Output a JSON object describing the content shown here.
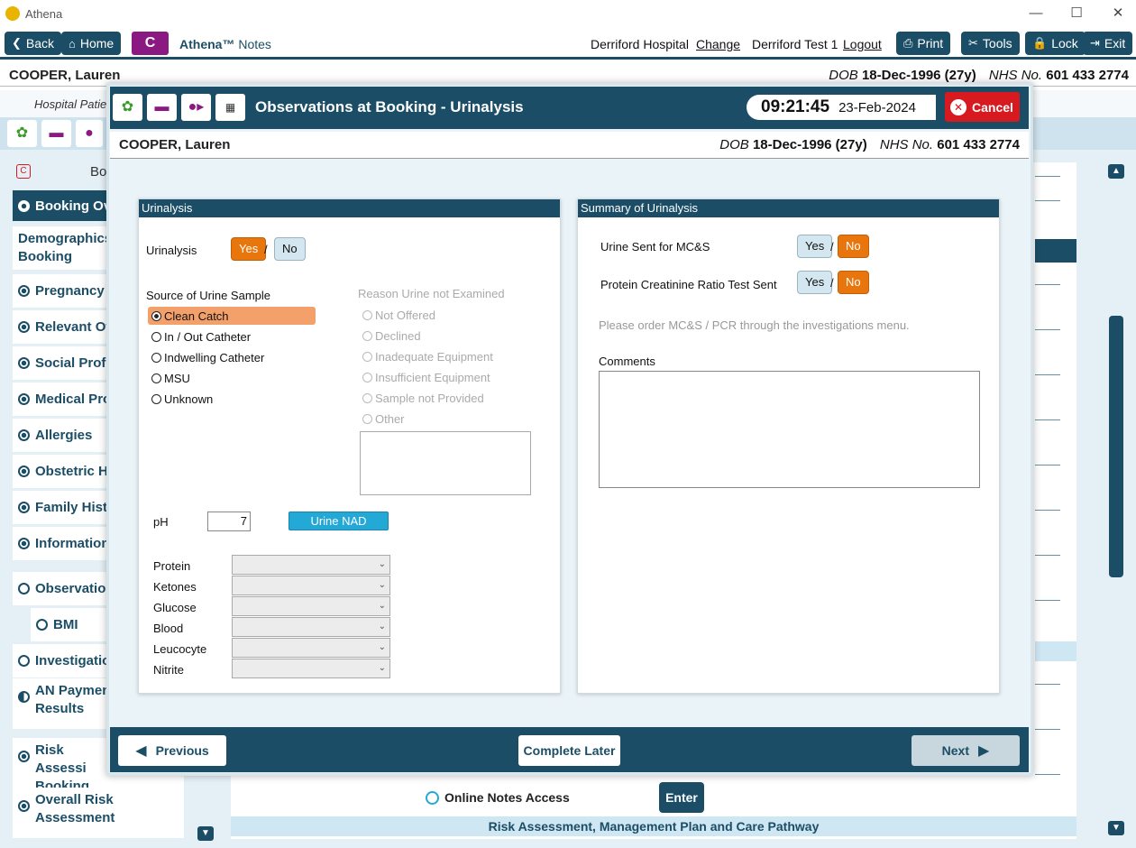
{
  "window": {
    "title": "Athena",
    "controls": [
      "—",
      "☐",
      "✕"
    ]
  },
  "toolbar": {
    "back": "Back",
    "home": "Home",
    "logo_letter": "C",
    "brand_name": "Athena™",
    "brand_suffix": "Notes",
    "hospital": "Derriford Hospital",
    "change": "Change",
    "user": "Derriford Test 1",
    "logout": "Logout",
    "print": "Print",
    "tools": "Tools",
    "lock": "Lock",
    "exit": "Exit"
  },
  "patient": {
    "name": "COOPER, Lauren",
    "dob_label": "DOB",
    "dob": "18-Dec-1996 (27y)",
    "nhs_label": "NHS No.",
    "nhs": "601 433 2774"
  },
  "background": {
    "hospital_partial": "Hospital Patie",
    "section_partial": "Bo",
    "online_notes": "Online Notes Access",
    "enter": "Enter",
    "risk_bar": "Risk Assessment, Management Plan and Care Pathway"
  },
  "sidebar": {
    "items": [
      {
        "label": "Booking Ov",
        "state": "selected"
      },
      {
        "label": "Demographics Booking",
        "state": "none"
      },
      {
        "label": "Pregnancy I",
        "state": "filled"
      },
      {
        "label": "Relevant Ot",
        "state": "filled"
      },
      {
        "label": "Social Profil",
        "state": "filled"
      },
      {
        "label": "Medical Pro",
        "state": "filled"
      },
      {
        "label": "Allergies",
        "state": "filled"
      },
      {
        "label": "Obstetric H",
        "state": "filled"
      },
      {
        "label": "Family Histo",
        "state": "filled"
      },
      {
        "label": "Information",
        "state": "filled"
      },
      {
        "label": "Observation",
        "state": "empty"
      },
      {
        "label": "BMI",
        "state": "empty"
      },
      {
        "label": "Investigatio",
        "state": "empty"
      },
      {
        "label": "AN Paymen Results",
        "state": "half"
      },
      {
        "label": "Risk Assessi Booking",
        "state": "filled"
      },
      {
        "label": "Overall Risk Assessment",
        "state": "filled"
      }
    ]
  },
  "modal": {
    "title": "Observations at Booking - Urinalysis",
    "time": "09:21:45",
    "date": "23-Feb-2024",
    "cancel": "Cancel",
    "urinalysis_panel": {
      "header": "Urinalysis",
      "urinalysis_label": "Urinalysis",
      "yes": "Yes",
      "no": "No",
      "urinalysis_value": "Yes",
      "source_label": "Source of Urine Sample",
      "sources": [
        "Clean Catch",
        "In / Out Catheter",
        "Indwelling Catheter",
        "MSU",
        "Unknown"
      ],
      "source_selected": "Clean Catch",
      "reason_label": "Reason Urine not Examined",
      "reasons": [
        "Not Offered",
        "Declined",
        "Inadequate Equipment",
        "Insufficient Equipment",
        "Sample not Provided",
        "Other"
      ],
      "reason_other_text": "",
      "ph_label": "pH",
      "ph_value": "7",
      "urine_nad": "Urine NAD",
      "tests": [
        "Protein",
        "Ketones",
        "Glucose",
        "Blood",
        "Leucocyte",
        "Nitrite"
      ],
      "test_values": [
        "",
        "",
        "",
        "",
        "",
        ""
      ]
    },
    "summary_panel": {
      "header": "Summary of Urinalysis",
      "mcs_label": "Urine Sent for MC&S",
      "mcs_value": "No",
      "pcr_label": "Protein Creatinine Ratio Test Sent",
      "pcr_value": "No",
      "yes": "Yes",
      "no": "No",
      "hint": "Please order MC&S / PCR through the investigations menu.",
      "comments_label": "Comments",
      "comments_value": ""
    },
    "footer": {
      "previous": "Previous",
      "complete_later": "Complete Later",
      "next": "Next"
    },
    "icons": [
      "flower-icon",
      "pill-icon",
      "mother-icon",
      "calendar-icon"
    ]
  },
  "colors": {
    "accent": "#1b4e66",
    "selected_orange": "#e8760d",
    "brand_purple": "#8a1a82",
    "cancel_red": "#d71920",
    "nad_blue": "#24a8d6"
  }
}
